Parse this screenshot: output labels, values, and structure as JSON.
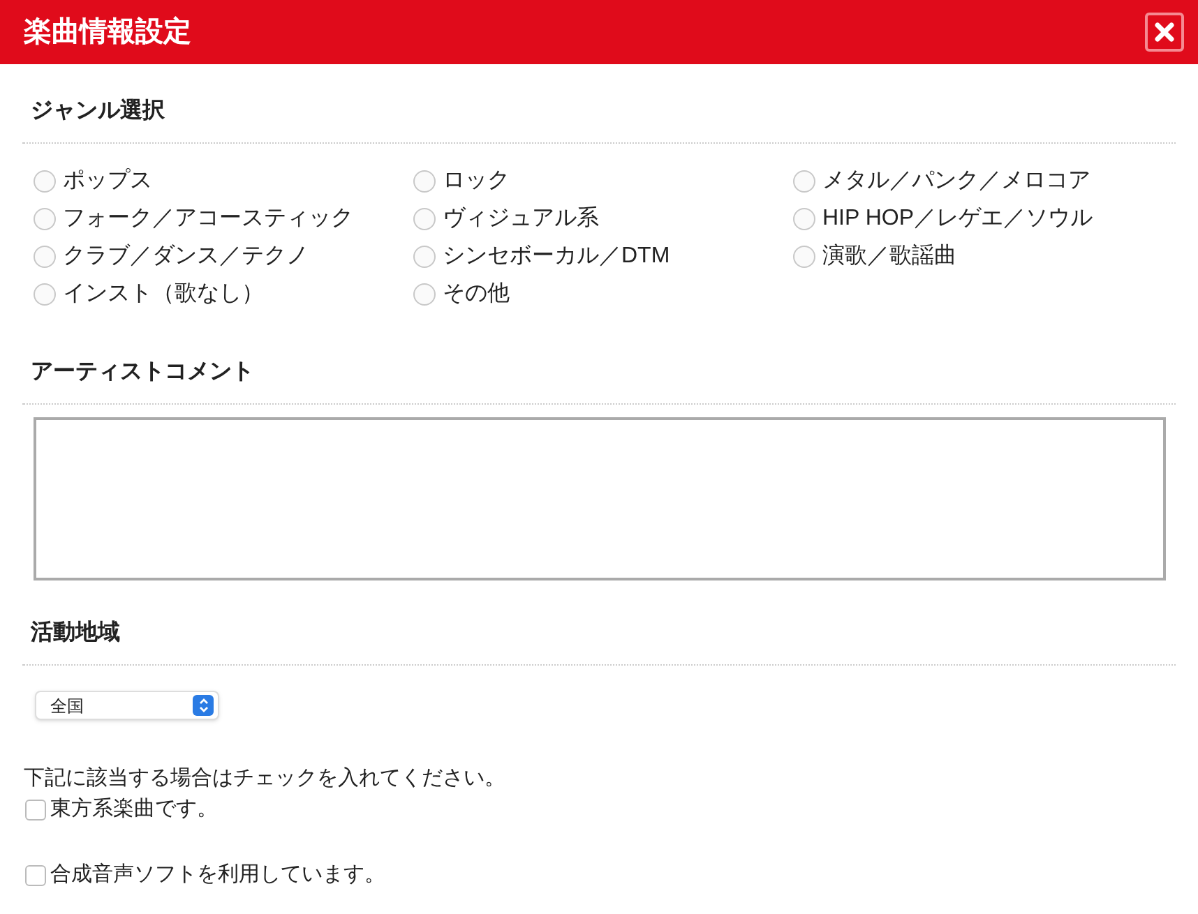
{
  "window": {
    "title": "楽曲情報設定"
  },
  "genre": {
    "heading": "ジャンル選択",
    "options": [
      {
        "label": "ポップス",
        "selected": false
      },
      {
        "label": "フォーク／アコースティック",
        "selected": false
      },
      {
        "label": "クラブ／ダンス／テクノ",
        "selected": false
      },
      {
        "label": "インスト（歌なし）",
        "selected": false
      },
      {
        "label": "ロック",
        "selected": false
      },
      {
        "label": "ヴィジュアル系",
        "selected": false
      },
      {
        "label": "シンセボーカル／DTM",
        "selected": false
      },
      {
        "label": "その他",
        "selected": false
      },
      {
        "label": "メタル／パンク／メロコア",
        "selected": false
      },
      {
        "label": "HIP HOP／レゲエ／ソウル",
        "selected": false
      },
      {
        "label": "演歌／歌謡曲",
        "selected": false
      }
    ]
  },
  "artist_comment": {
    "heading": "アーティストコメント"
  },
  "region": {
    "heading": "活動地域",
    "value": "全国"
  },
  "note": "下記に該当する場合はチェックを入れてください。",
  "checkboxes": [
    {
      "label": "東方系楽曲です。",
      "checked": false
    },
    {
      "label": "合成音声ソフトを利用しています。",
      "checked": false
    }
  ]
}
